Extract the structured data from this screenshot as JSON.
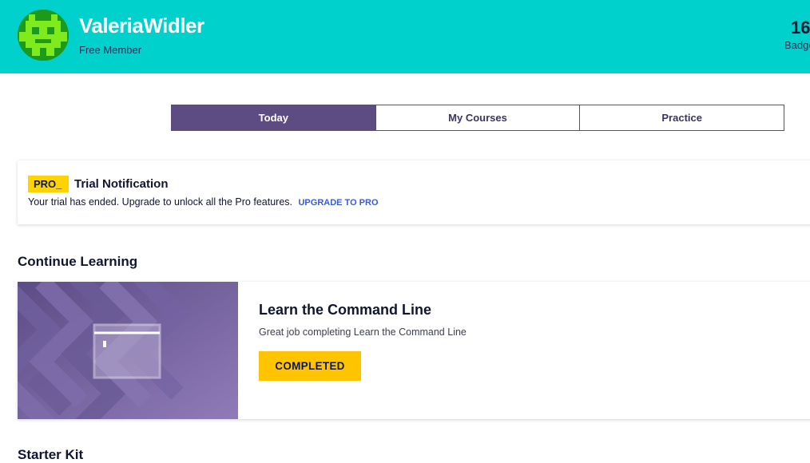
{
  "header": {
    "user_name": "ValeriaWidler",
    "membership": "Free Member",
    "badge_count": "16",
    "badge_label": "Badges",
    "background_color": "#00d1cd",
    "avatar_icon": "pixel-alien-icon"
  },
  "tabs": [
    {
      "label": "Today",
      "active": true
    },
    {
      "label": "My Courses",
      "active": false
    },
    {
      "label": "Practice",
      "active": false
    }
  ],
  "trial": {
    "badge": "PRO_",
    "title": "Trial Notification",
    "message": "Your trial has ended. Upgrade to unlock all the Pro features.",
    "link_label": "UPGRADE TO PRO",
    "badge_color": "#ffd300",
    "link_color": "#3a5bd9"
  },
  "continue_learning": {
    "heading": "Continue Learning",
    "course": {
      "title": "Learn the Command Line",
      "description": "Great job completing Learn the Command Line",
      "button_label": "COMPLETED",
      "button_color": "#ffc400",
      "art_icon": "terminal-window-icon"
    }
  },
  "starter_kit": {
    "heading": "Starter Kit"
  }
}
